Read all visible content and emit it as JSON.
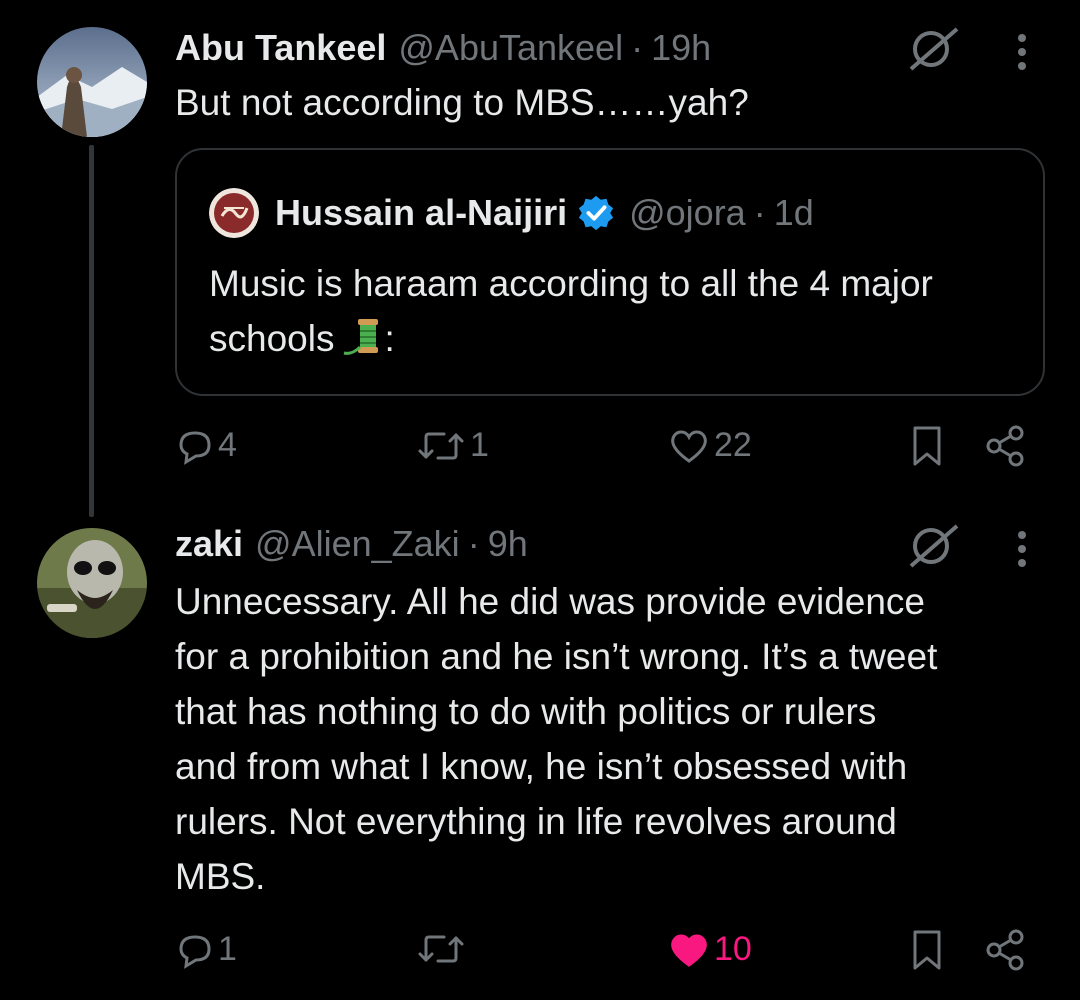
{
  "thread": {
    "tweet1": {
      "name": "Abu Tankeel",
      "handle": "@AbuTankeel",
      "separator": "·",
      "time": "19h",
      "text": "But not according to MBS……yah?",
      "quote": {
        "name": "Hussain al-Naijiri",
        "handle": "@ojora",
        "separator": "·",
        "time": "1d",
        "text": "Music is haraam according to all the 4 major schools",
        "text_suffix": ":"
      },
      "actions": {
        "replies": "4",
        "retweets": "1",
        "likes": "22"
      }
    },
    "tweet2": {
      "name": "zaki",
      "handle": "@Alien_Zaki",
      "separator": "·",
      "time": "9h",
      "lines": [
        "Unnecessary. All he did was provide evidence",
        "for a prohibition and he isn’t wrong. It’s a tweet",
        "that has nothing to do with politics or rulers",
        "and from what I know, he isn’t obsessed with",
        "rulers. Not everything in life revolves around",
        "MBS."
      ],
      "actions": {
        "replies": "1",
        "retweets": "",
        "likes": "10",
        "liked": true
      }
    }
  },
  "colors": {
    "background": "#000000",
    "text": "#e7e9ea",
    "muted": "#71767b",
    "like": "#f91880",
    "verified": "#1d9bf0"
  },
  "icons": [
    "grok-icon",
    "more-vertical-icon",
    "reply-icon",
    "retweet-icon",
    "heart-icon",
    "bookmark-icon",
    "share-icon",
    "verified-icon",
    "spool-emoji"
  ]
}
